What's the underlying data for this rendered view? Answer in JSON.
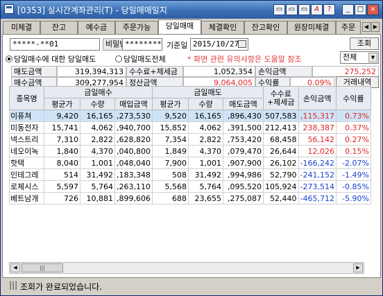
{
  "window": {
    "title": "[0353] 실시간계좌관리(T) - 당일매매일지",
    "buttons": [
      "▭",
      "▭",
      "▭",
      "A",
      "?",
      "_",
      "□",
      "×"
    ]
  },
  "tabs": [
    "미체결",
    "잔고",
    "예수금",
    "주문가능",
    "당일매매",
    "체결확인",
    "잔고확인",
    "원장미체결",
    "주문"
  ],
  "active_tab": "당일매매",
  "form": {
    "account": "*****-**01",
    "password_label": "비밀번호",
    "password": "********",
    "date_label": "기준일",
    "date": "2015/10/27",
    "query_button": "조회",
    "radio1": "당일매수에 대한 당일매도",
    "radio2": "당일매도전체",
    "notice": "* 화면 관련 유의사항은 도움말 참조",
    "filter": "전체"
  },
  "summary": {
    "buy_label": "매도금액",
    "buy_value": "319,394,313",
    "fee_label": "수수료+제세금",
    "fee_value": "1,052,354",
    "pnl_label": "손익금액",
    "pnl_value": "275,252",
    "sell_label": "매수금액",
    "sell_value": "309,277,954",
    "settle_label": "정산금액",
    "settle_value": "9,064,005",
    "rate_label": "수익률",
    "rate_value": "0.09%",
    "history_button": "거래내역"
  },
  "table": {
    "group_headers": [
      "종목명",
      "금일매수",
      "금일매도",
      "수수료+제세금",
      "손익금액",
      "수익률"
    ],
    "sub_headers": [
      "평균가",
      "수량",
      "매입금액",
      "평균가",
      "수량",
      "매도금액"
    ],
    "rows": [
      {
        "name": "이퓨쳐",
        "buy_avg": "9,420",
        "buy_qty": "16,165",
        "buy_amt": ",273,530",
        "sell_avg": "9,520",
        "sell_qty": "16,165",
        "sell_amt": ",896,430",
        "fee": "507,583",
        "pnl": ",115,317",
        "rate": "0.73%",
        "sign": "pos"
      },
      {
        "name": "미동전자",
        "buy_avg": "15,741",
        "buy_qty": "4,062",
        "buy_amt": ",940,700",
        "sell_avg": "15,852",
        "sell_qty": "4,062",
        "sell_amt": ",391,500",
        "fee": "212,413",
        "pnl": "238,387",
        "rate": "0.37%",
        "sign": "pos"
      },
      {
        "name": "넥스트리",
        "buy_avg": "7,310",
        "buy_qty": "2,822",
        "buy_amt": ",628,820",
        "sell_avg": "7,354",
        "sell_qty": "2,822",
        "sell_amt": ",753,420",
        "fee": "68,458",
        "pnl": "56,142",
        "rate": "0.27%",
        "sign": "pos"
      },
      {
        "name": "네오이녹",
        "buy_avg": "1,840",
        "buy_qty": "4,370",
        "buy_amt": ",040,800",
        "sell_avg": "1,849",
        "sell_qty": "4,370",
        "sell_amt": ",079,470",
        "fee": "26,644",
        "pnl": "12,026",
        "rate": "0.15%",
        "sign": "pos"
      },
      {
        "name": "핫텍",
        "buy_avg": "8,040",
        "buy_qty": "1,001",
        "buy_amt": ",048,040",
        "sell_avg": "7,900",
        "sell_qty": "1,001",
        "sell_amt": ",907,900",
        "fee": "26,102",
        "pnl": "-166,242",
        "rate": "-2.07%",
        "sign": "neg"
      },
      {
        "name": "인테그레",
        "buy_avg": "514",
        "buy_qty": "31,492",
        "buy_amt": ",183,348",
        "sell_avg": "508",
        "sell_qty": "31,492",
        "sell_amt": ",994,986",
        "fee": "52,790",
        "pnl": "-241,152",
        "rate": "-1.49%",
        "sign": "neg"
      },
      {
        "name": "로체시스",
        "buy_avg": "5,597",
        "buy_qty": "5,764",
        "buy_amt": ",263,110",
        "sell_avg": "5,568",
        "sell_qty": "5,764",
        "sell_amt": ",095,520",
        "fee": "105,924",
        "pnl": "-273,514",
        "rate": "-0.85%",
        "sign": "neg"
      },
      {
        "name": "베트남개",
        "buy_avg": "726",
        "buy_qty": "10,881",
        "buy_amt": ",899,606",
        "sell_avg": "688",
        "sell_qty": "23,655",
        "sell_amt": ",275,087",
        "fee": "52,440",
        "pnl": "-465,712",
        "rate": "-5.90%",
        "sign": "neg"
      }
    ]
  },
  "scrollbar_thumb": "|||",
  "status": "조회가 완료되었습니다.",
  "colors": {
    "positive": "#e0262a",
    "negative": "#1a3fd0",
    "selected_row": "#cfe3f6"
  }
}
